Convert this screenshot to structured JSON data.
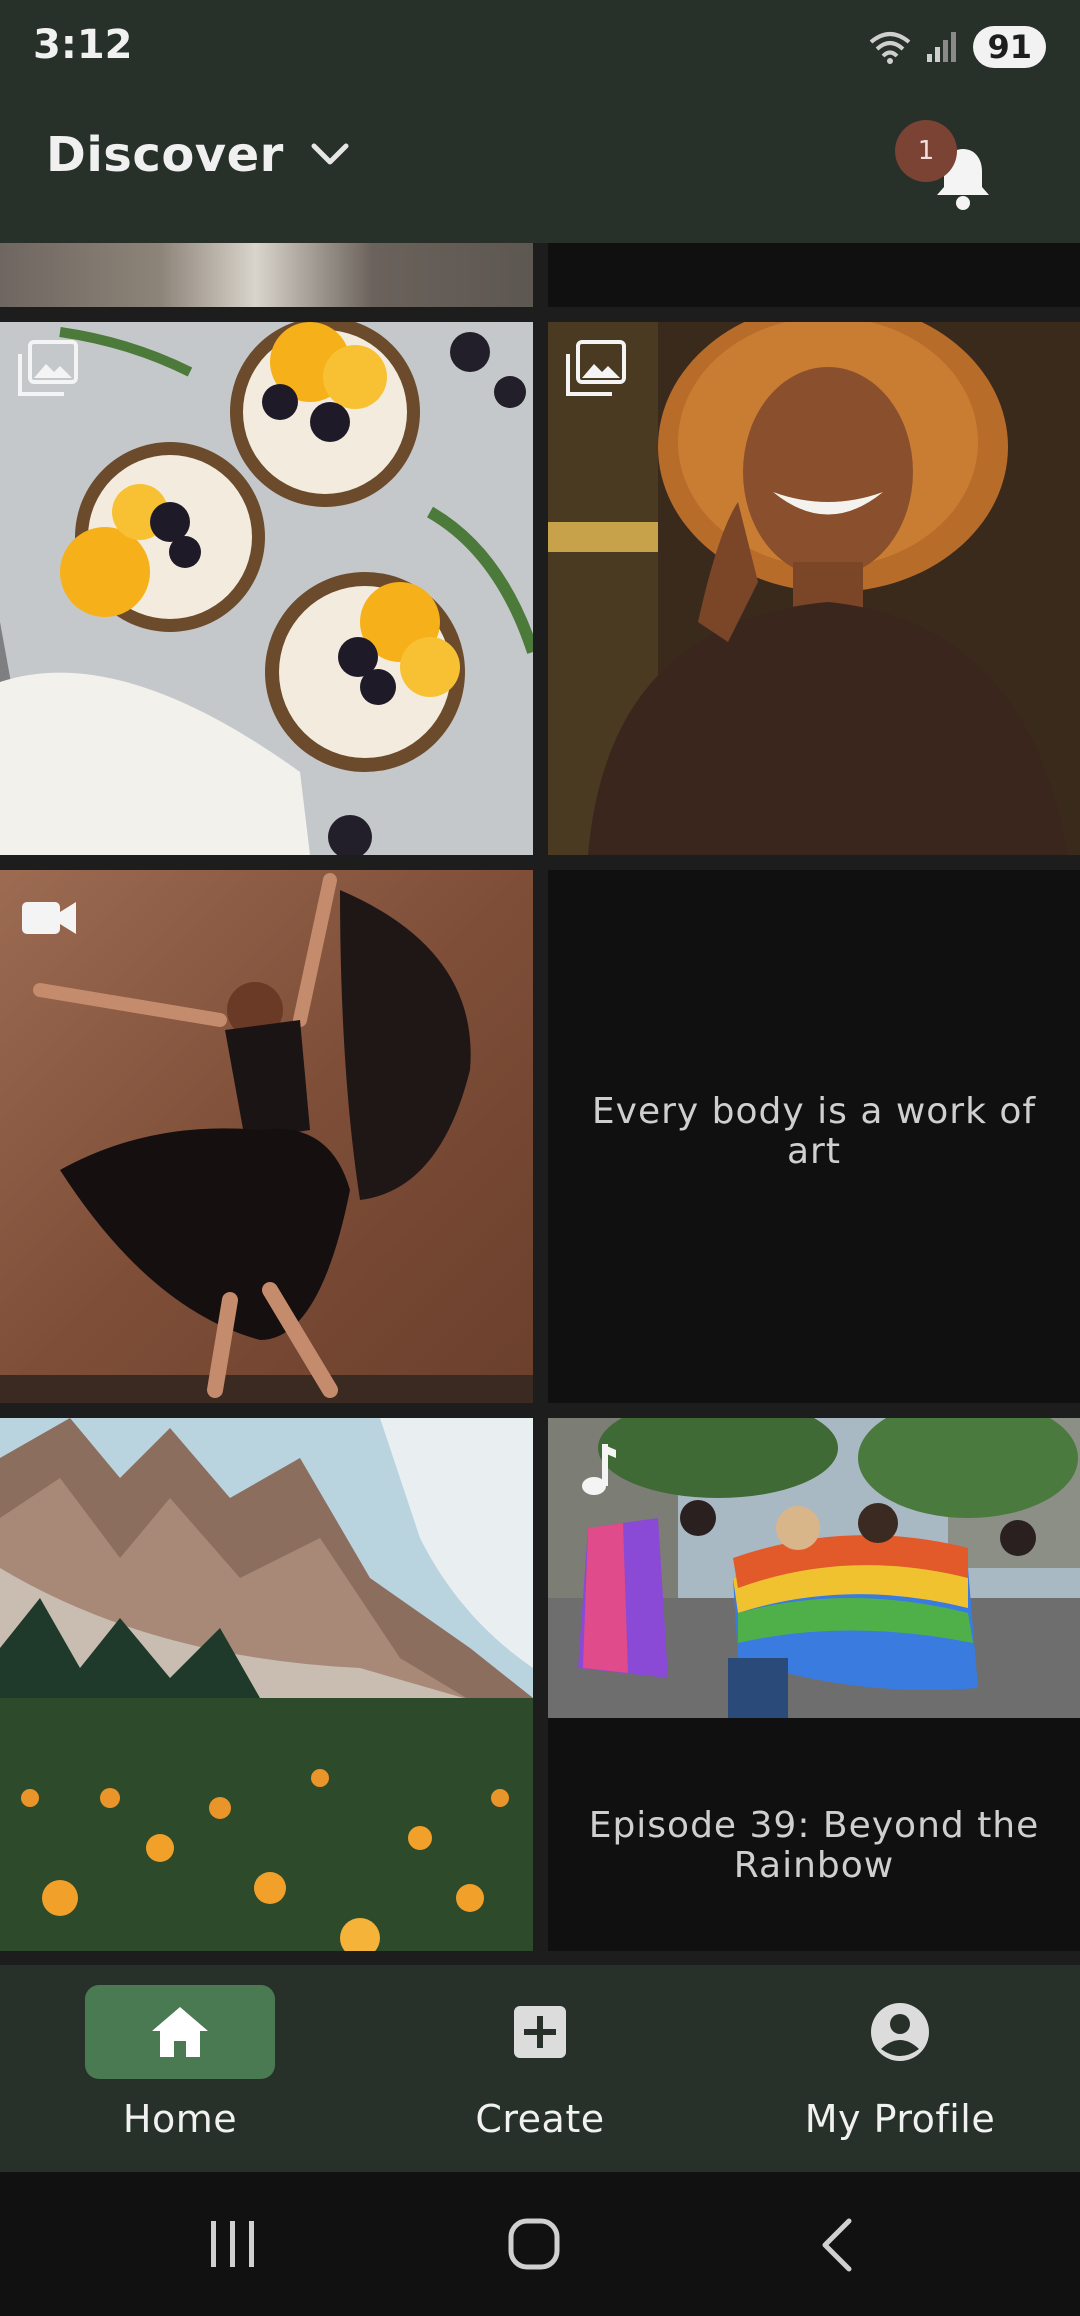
{
  "status_bar": {
    "time": "3:12",
    "battery": "91",
    "icons": [
      "wifi-icon",
      "signal-icon",
      "battery-icon"
    ]
  },
  "header": {
    "title": "Discover",
    "notification_count": "1"
  },
  "feed": {
    "tiles": [
      {
        "kind": "image",
        "subject": "feet on blanket (partially scrolled)"
      },
      {
        "kind": "text-empty"
      },
      {
        "kind": "image",
        "icon": "gallery-icon",
        "subject": "citrus blackberry tarts"
      },
      {
        "kind": "image",
        "icon": "gallery-icon",
        "subject": "smiling woman with curly hair"
      },
      {
        "kind": "video",
        "icon": "video-icon",
        "subject": "dancer in black dress"
      },
      {
        "kind": "text",
        "caption": "Every body is a work of art"
      },
      {
        "kind": "image",
        "subject": "mountain meadow with orange flowers"
      },
      {
        "kind": "audio",
        "icon": "music-note-icon",
        "subject": "pride parade",
        "caption": "Episode 39: Beyond the Rainbow"
      }
    ]
  },
  "bottom_nav": {
    "items": [
      {
        "label": "Home",
        "icon": "home-icon",
        "active": true
      },
      {
        "label": "Create",
        "icon": "add-box-icon",
        "active": false
      },
      {
        "label": "My Profile",
        "icon": "account-circle-icon",
        "active": false
      }
    ]
  },
  "colors": {
    "header_bg": "#273029",
    "active_nav": "#4a7a52",
    "badge": "#7a4334",
    "tile_dark": "#101010"
  }
}
